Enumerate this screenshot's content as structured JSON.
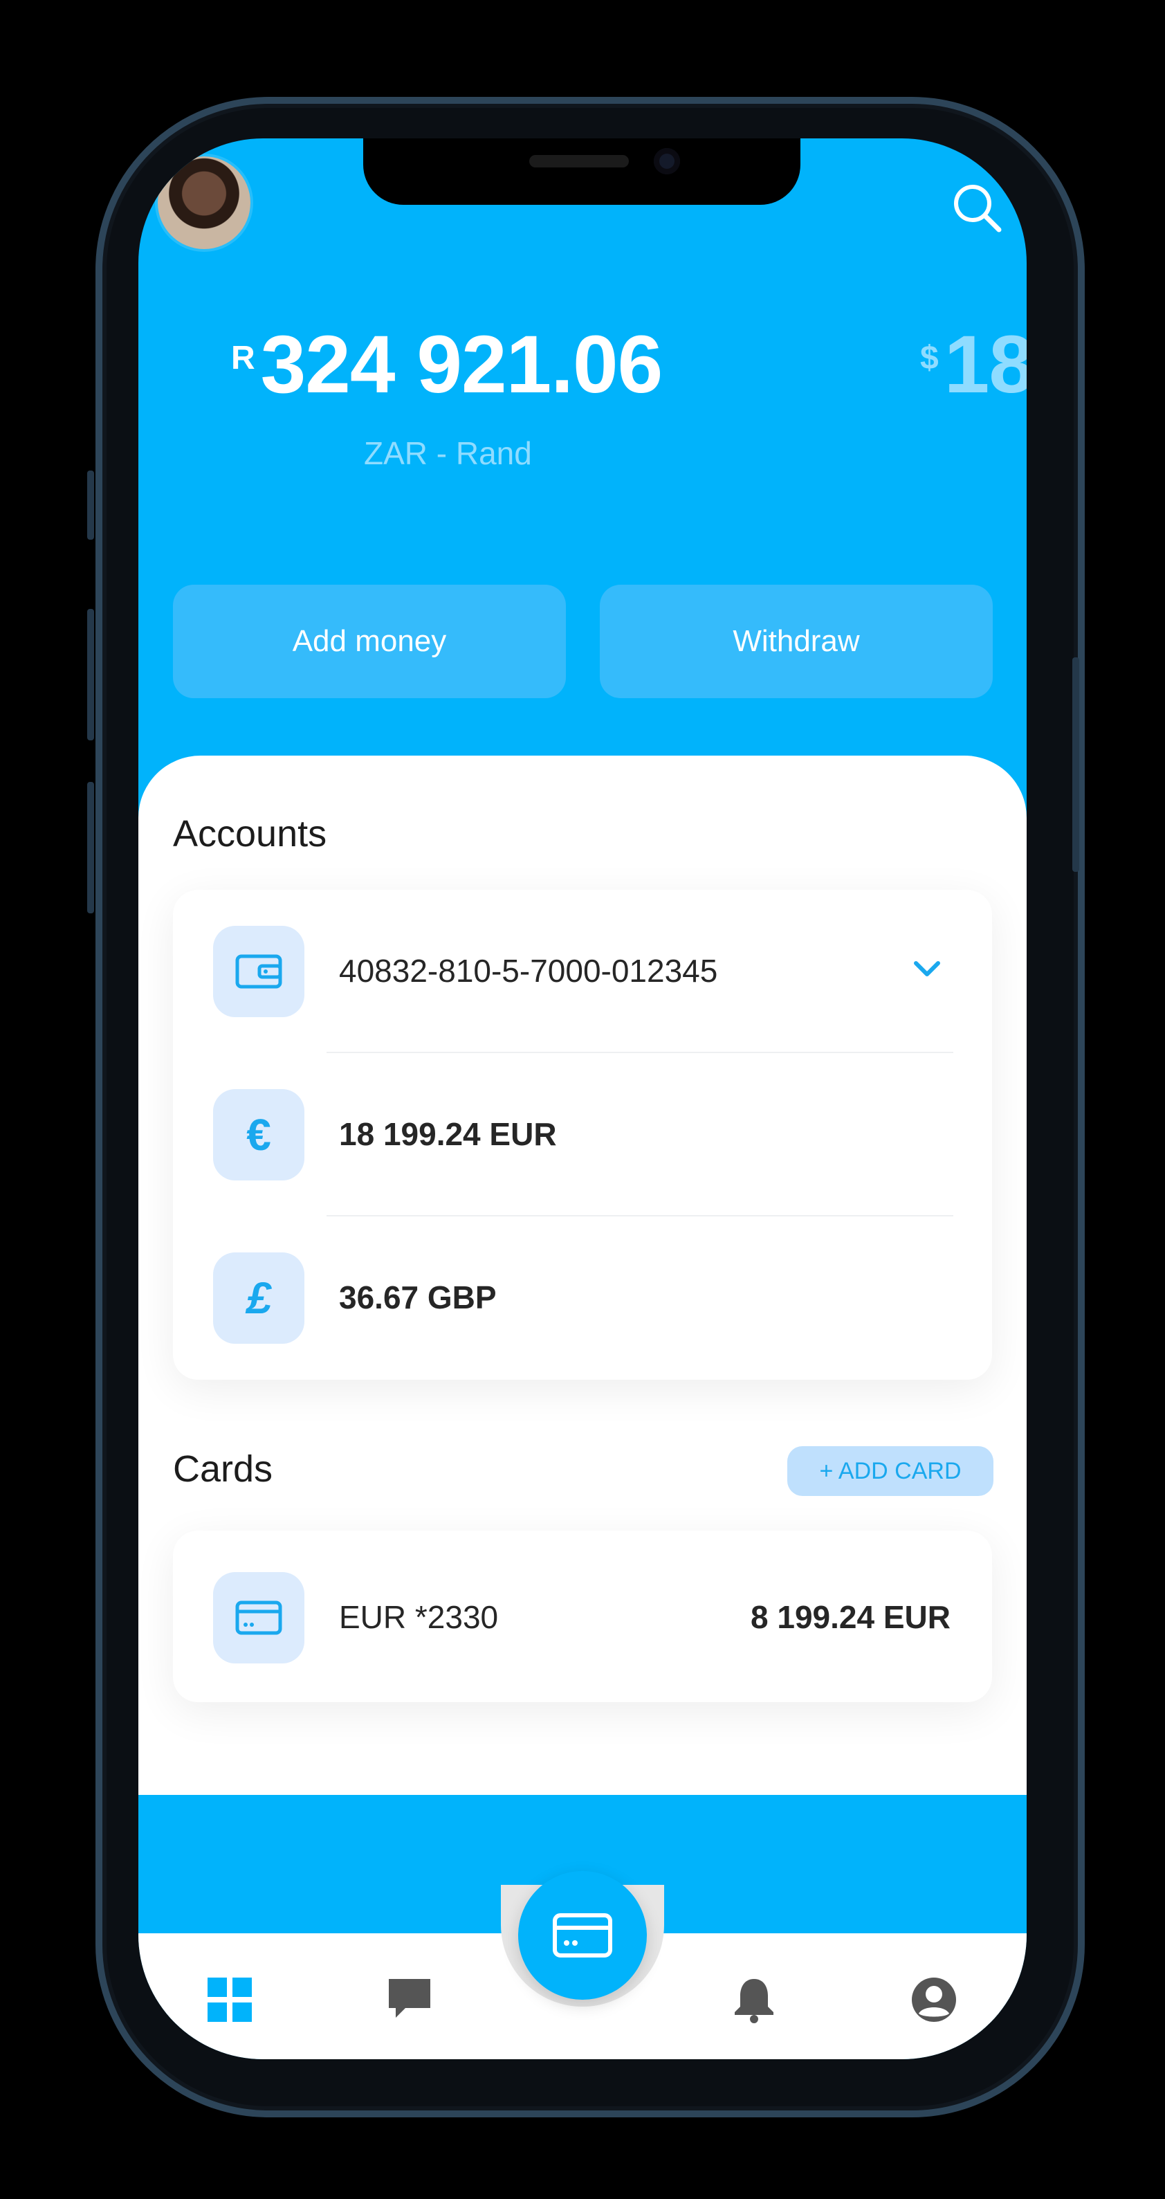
{
  "header": {
    "avatar": "user-avatar",
    "search_icon": "search-icon"
  },
  "balances": [
    {
      "symbol": "R",
      "amount": "324 921.06",
      "label": "ZAR - Rand"
    },
    {
      "symbol": "$",
      "amount": "18"
    }
  ],
  "actions": {
    "add_money": "Add money",
    "withdraw": "Withdraw"
  },
  "accounts": {
    "title": "Accounts",
    "items": [
      {
        "icon": "wallet-icon",
        "text": "40832-810-5-7000-012345",
        "expandable": true
      },
      {
        "icon": "euro-icon",
        "glyph": "€",
        "text": "18 199.24 EUR"
      },
      {
        "icon": "pound-icon",
        "glyph": "£",
        "text": "36.67 GBP"
      }
    ]
  },
  "cards": {
    "title": "Cards",
    "add_label": "+ ADD CARD",
    "items": [
      {
        "icon": "credit-card-icon",
        "name": "EUR *2330",
        "amount": "8 199.24 EUR"
      }
    ]
  },
  "tabbar": {
    "items": [
      "dashboard-icon",
      "chat-icon",
      "cards-icon",
      "bell-icon",
      "profile-icon"
    ],
    "active": "dashboard-icon"
  },
  "colors": {
    "brand": "#01b3fb",
    "accent_text": "#1aa8ee",
    "icon_bg": "#dcebfd"
  }
}
